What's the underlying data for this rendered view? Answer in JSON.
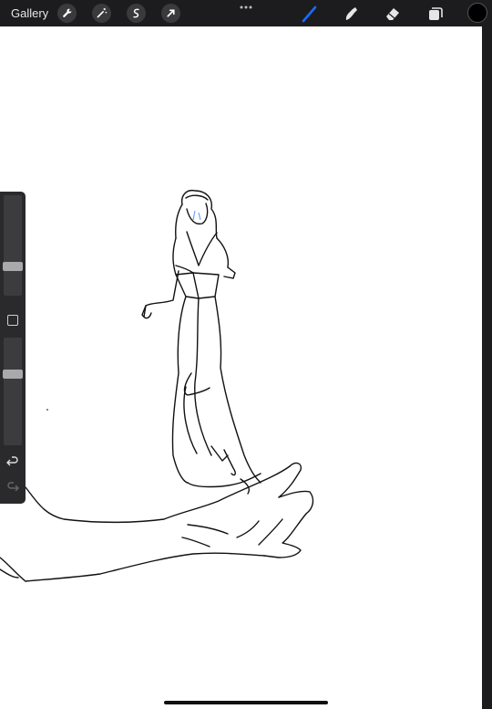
{
  "toolbar": {
    "gallery_label": "Gallery",
    "left_tools": [
      "wrench-icon",
      "magic-wand-icon",
      "selection-icon",
      "transform-arrow-icon"
    ],
    "right_tools": [
      "brush-icon",
      "smudge-icon",
      "eraser-icon",
      "layers-icon"
    ],
    "active_tool": "brush-icon",
    "active_color": "#1a6cff",
    "current_color": "#000000"
  },
  "sidebar": {
    "brush_size_level": 0.27,
    "opacity_level": 0.68
  }
}
